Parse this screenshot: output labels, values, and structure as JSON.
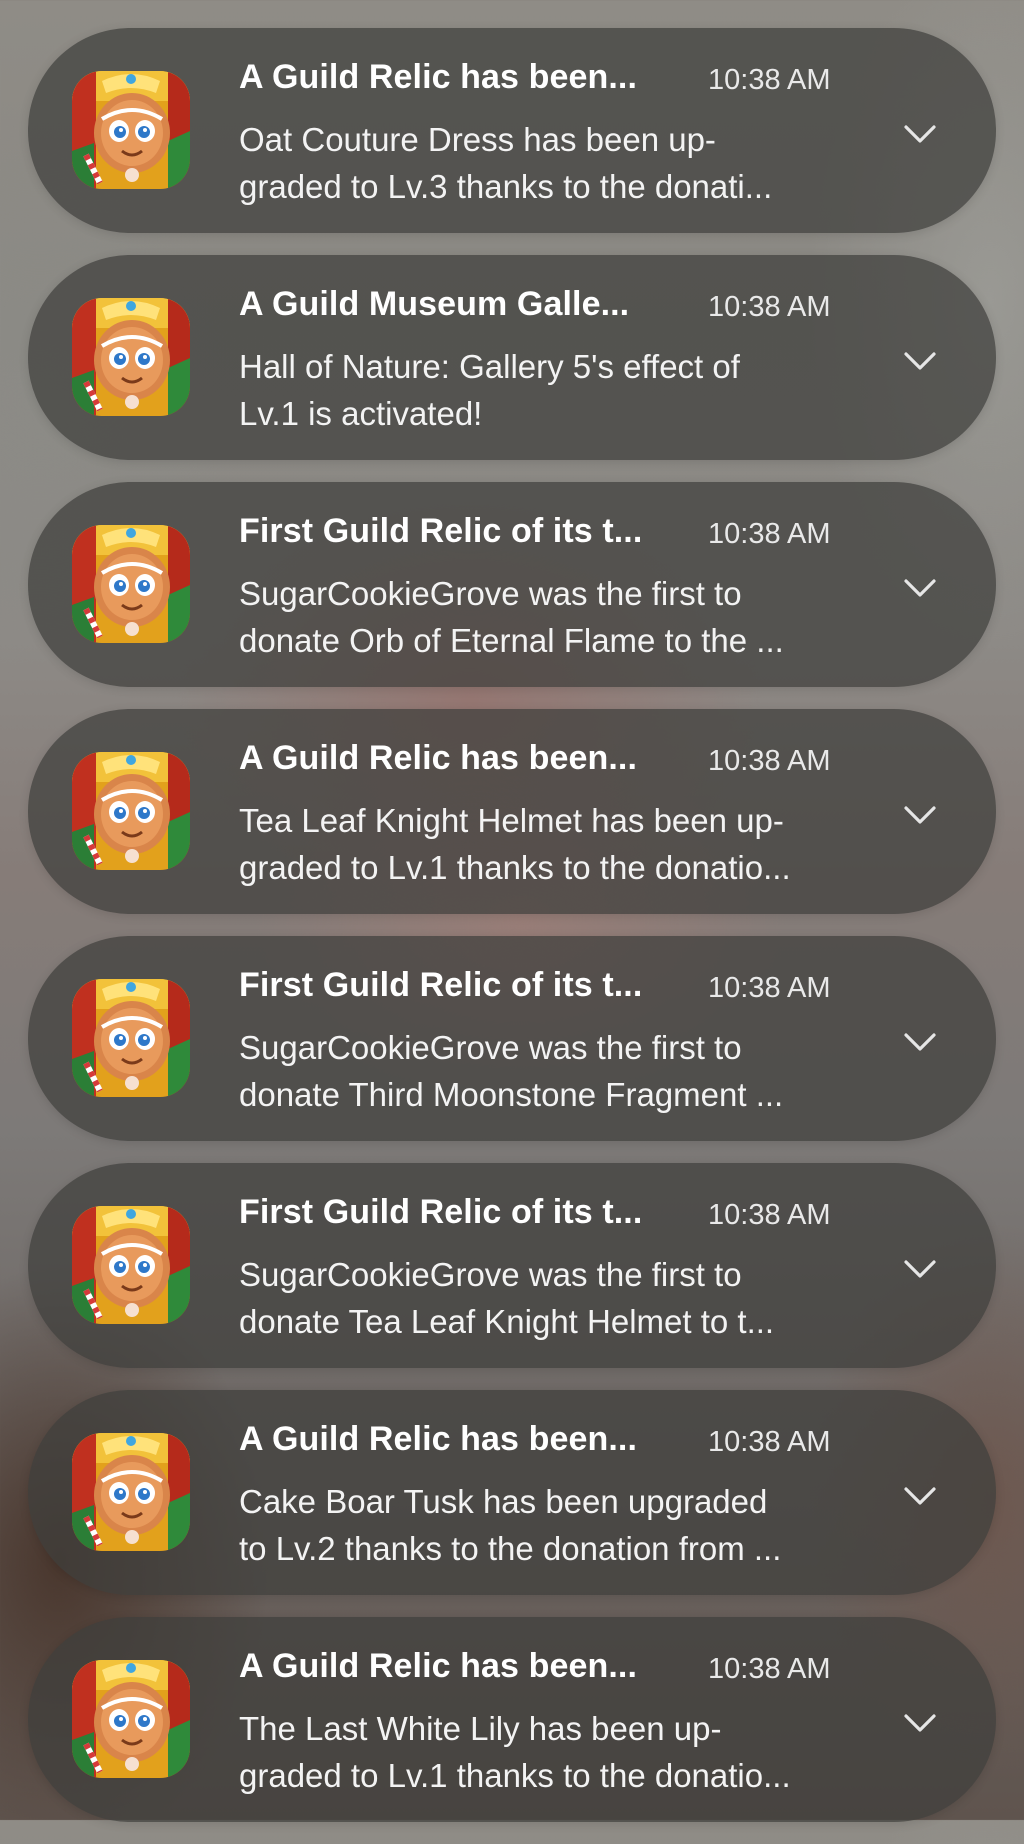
{
  "notifications": [
    {
      "title": "A Guild Relic has been...",
      "time": "10:38 AM",
      "line1": "Oat Couture Dress has been up-",
      "line2": "graded to Lv.3 thanks to the donati..."
    },
    {
      "title": "A Guild Museum Galle...",
      "time": "10:38 AM",
      "line1": "Hall of Nature: Gallery 5's effect of",
      "line2": "Lv.1 is activated!"
    },
    {
      "title": "First Guild Relic of its t...",
      "time": "10:38 AM",
      "line1": "SugarCookieGrove was the first to",
      "line2": "donate Orb of Eternal Flame to the ..."
    },
    {
      "title": "A Guild Relic has been...",
      "time": "10:38 AM",
      "line1": "Tea Leaf Knight Helmet has been up-",
      "line2": "graded to Lv.1 thanks to the donatio..."
    },
    {
      "title": "First Guild Relic of its t...",
      "time": "10:38 AM",
      "line1": "SugarCookieGrove was the first to",
      "line2": "donate Third Moonstone Fragment ..."
    },
    {
      "title": "First Guild Relic of its t...",
      "time": "10:38 AM",
      "line1": "SugarCookieGrove was the first to",
      "line2": "donate Tea Leaf Knight Helmet to t..."
    },
    {
      "title": "A Guild Relic has been...",
      "time": "10:38 AM",
      "line1": "Cake Boar Tusk has been upgraded",
      "line2": "to Lv.2 thanks to the donation from ..."
    },
    {
      "title": "A Guild Relic has been...",
      "time": "10:38 AM",
      "line1": "The Last White Lily has been up-",
      "line2": "graded to Lv.1 thanks to the donatio..."
    }
  ],
  "icons": {
    "app": "cookie-run-app-icon",
    "expand": "chevron-down-icon"
  },
  "colors": {
    "card_background": "#3e3e3c",
    "title_text": "#ffffff",
    "body_text": "#f3f3f3"
  }
}
